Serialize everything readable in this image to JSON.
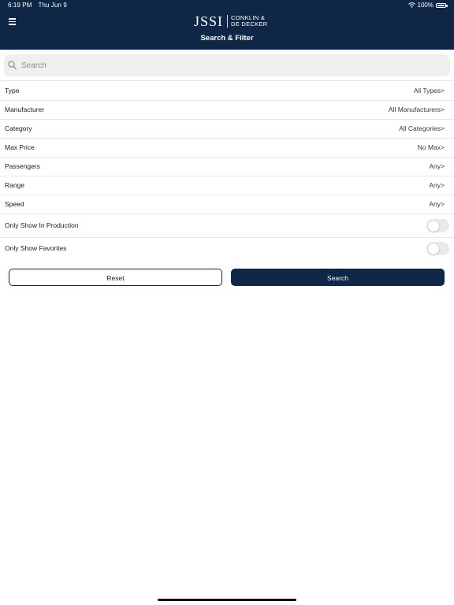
{
  "status_bar": {
    "time": "6:19 PM",
    "date": "Thu Jun 9",
    "battery": "100%",
    "icons": [
      "wifi-icon",
      "battery-icon"
    ]
  },
  "header": {
    "logo_main": "JSSI",
    "logo_line1": "CONKLIN &",
    "logo_line2": "DE DECKER",
    "title": "Search & Filter",
    "menu_icon": "hamburger-menu-icon",
    "background": "#0f2746"
  },
  "search": {
    "placeholder": "Search",
    "value": "",
    "icon": "magnifier-icon"
  },
  "filters": [
    {
      "label": "Type",
      "value": "All Types>"
    },
    {
      "label": "Manufacturer",
      "value": "All Manufacturers>"
    },
    {
      "label": "Category",
      "value": "All Categories>"
    },
    {
      "label": "Max Price",
      "value": "No Max>"
    },
    {
      "label": "Passengers",
      "value": "Any>"
    },
    {
      "label": "Range",
      "value": "Any>"
    },
    {
      "label": "Speed",
      "value": "Any>"
    }
  ],
  "toggles": [
    {
      "label": "Only Show In Production",
      "on": false
    },
    {
      "label": "Only Show Favorites",
      "on": false
    }
  ],
  "buttons": {
    "reset": "Reset",
    "search": "Search"
  },
  "colors": {
    "accent": "#0f2746",
    "toggle_off": "#e9e9eb"
  }
}
